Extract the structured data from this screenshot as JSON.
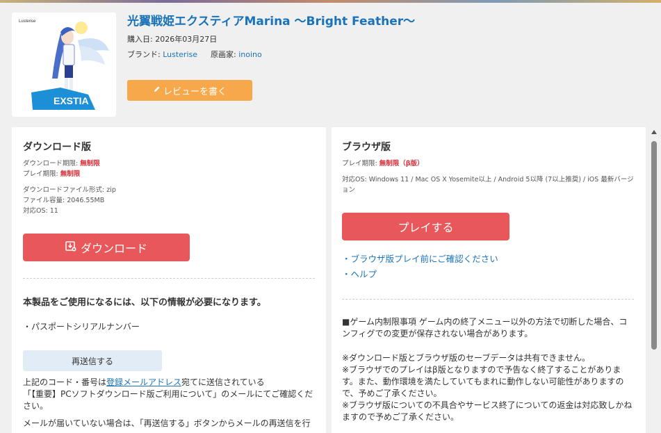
{
  "product": {
    "title": "光翼戦姫エクスティアMarina 〜Bright Feather〜",
    "purchase_label": "購入日: ",
    "purchase_date": "2026年03月27日",
    "brand_label": "ブランド: ",
    "brand": "Lusterise",
    "artist_label": "原画家: ",
    "artist": "inoino",
    "review_button": "レビューを書く",
    "thumb_brand_text": "Lusterise"
  },
  "download": {
    "heading": "ダウンロード版",
    "dl_period_label": "ダウンロード期限: ",
    "dl_period_value": "無制限",
    "play_period_label": "プレイ期限: ",
    "play_period_value": "無制限",
    "file_format": "ダウンロードファイル形式: zip",
    "file_size": "ファイル容量: 2046.55MB",
    "os": "対応OS: 11",
    "button": "ダウンロード"
  },
  "info": {
    "heading": "本製品をご使用になるには、以下の情報が必要になります。",
    "item": "・パスポートシリアルナンバー",
    "resend_button": "再送信する",
    "desc_pre": "上記のコード・番号は",
    "desc_link": "登録メールアドレス",
    "desc_post": "宛てに送信されている",
    "desc2": "「【重要】PCソフトダウンロード版ご利用について」のメールにてご確認ください。",
    "desc3": "メールが届いていない場合は、「再送信する」ボタンからメールの再送信を行"
  },
  "browser": {
    "heading": "ブラウザ版",
    "play_period_label": "プレイ期限: ",
    "play_period_value": "無制限（β版）",
    "os": "対応OS: Windows 11 / Mac OS X Yosemite以上 / Android 5以降 (7以上推奨) / iOS 最新バージョン",
    "play_button": "プレイする",
    "link1": "・ブラウザ版プレイ前にご確認ください",
    "link2": "・ヘルプ",
    "notice1": "■ゲーム内制限事項 ゲーム内の終了メニュー以外の方法で切断した場合、コンフィグでの変更が保存されない場合があります。",
    "notice2": "※ダウンロード版とブラウザ版のセーブデータは共有できません。",
    "notice3": "※ブラウザでのプレイはβ版となりますので予告なく終了することがあります。また、動作環境を満たしていてもまれに動作しない可能性がありますので、予めご了承ください。",
    "notice4": "※ブラウザ版についての不具合やサービス終了についての返金は対応致しかねますので予めご了承ください。"
  },
  "colors": {
    "title_blue": "#1a73b8",
    "review_orange": "#f7a84a",
    "primary_red": "#e8585a",
    "warn_red": "#d9303a"
  },
  "icons": [
    "pencil-icon",
    "download-icon",
    "scroll-up-icon"
  ]
}
